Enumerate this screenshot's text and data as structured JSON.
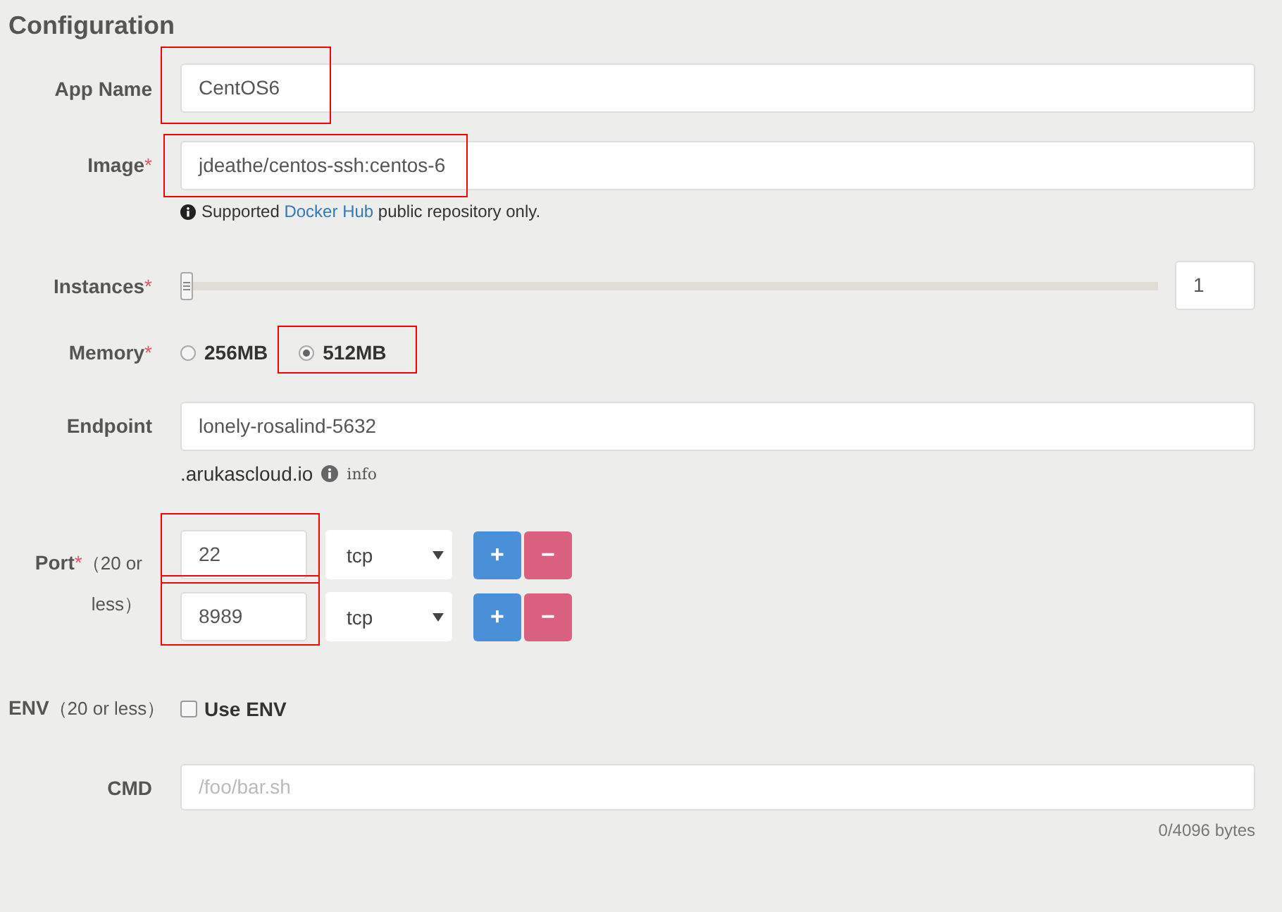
{
  "title": "Configuration",
  "app_name": {
    "label": "App Name",
    "value": "CentOS6",
    "highlighted": true
  },
  "image": {
    "label": "Image",
    "required_mark": "*",
    "value": "jdeathe/centos-ssh:centos-6",
    "highlighted": true,
    "help_before": "Supported ",
    "help_link": "Docker Hub",
    "help_after": " public repository only."
  },
  "instances": {
    "label": "Instances",
    "required_mark": "*",
    "level": 0,
    "value": "1"
  },
  "memory": {
    "label": "Memory",
    "required_mark": "*",
    "options": [
      {
        "label": "256MB",
        "selected": false,
        "highlighted": false
      },
      {
        "label": "512MB",
        "selected": true,
        "highlighted": true
      }
    ]
  },
  "endpoint": {
    "label": "Endpoint",
    "value": "lonely-rosalind-5632",
    "suffix": ".arukascloud.io",
    "info": "info"
  },
  "port": {
    "label": "Port",
    "required_mark": "*",
    "note": "（20 or less）",
    "rows": [
      {
        "value": "22",
        "protocol": "tcp",
        "highlighted": true,
        "add": "+",
        "remove": "−"
      },
      {
        "value": "8989",
        "protocol": "tcp",
        "highlighted": true,
        "add": "+",
        "remove": "−"
      }
    ]
  },
  "env": {
    "label": "ENV",
    "note": "（20 or less）",
    "checkbox": {
      "label": "Use ENV",
      "checked": false
    }
  },
  "cmd": {
    "label": "CMD",
    "placeholder": "/foo/bar.sh",
    "counter": "0/4096 bytes"
  }
}
